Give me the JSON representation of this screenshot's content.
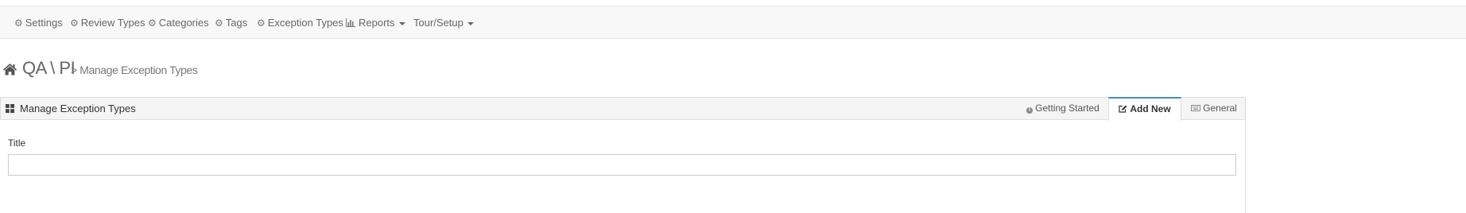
{
  "nav": {
    "items": [
      {
        "label": "Settings",
        "icon": "gear-icon"
      },
      {
        "label": "Review Types",
        "icon": "gear-icon"
      },
      {
        "label": "Categories",
        "icon": "gear-icon"
      },
      {
        "label": "Tags",
        "icon": "gear-icon"
      },
      {
        "label": "Exception Types",
        "icon": "gear-icon"
      },
      {
        "label": "Reports",
        "icon": "bar-chart-icon",
        "dropdown": true
      },
      {
        "label": "Tour/Setup",
        "dropdown": true
      }
    ]
  },
  "header": {
    "brand": "QA \\ PI",
    "breadcrumb": "> Manage Exception Types"
  },
  "panel": {
    "title": "Manage Exception Types",
    "tabs": [
      {
        "label": "Getting Started",
        "icon": "info-icon"
      },
      {
        "label": "Add New",
        "icon": "edit-icon",
        "active": true
      },
      {
        "label": "General",
        "icon": "keyboard-icon"
      }
    ]
  },
  "form": {
    "title_label": "Title",
    "title_value": "",
    "title_placeholder": ""
  },
  "colors": {
    "navbar_bg": "#f8f8f8",
    "active_tab_accent": "#4a89c7",
    "panel_head_bg": "#f5f5f5"
  }
}
